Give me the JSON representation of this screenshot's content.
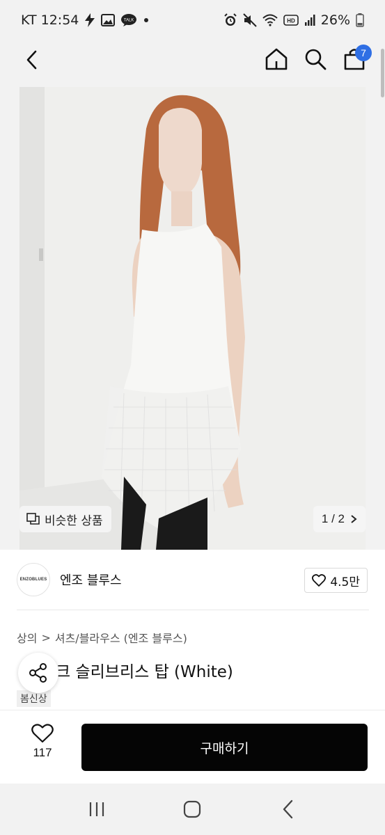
{
  "status_bar": {
    "carrier_time": "KT 12:54",
    "battery": "26%",
    "icons": [
      "bolt-icon",
      "gallery-icon",
      "talk-icon",
      "dot-icon",
      "alarm-icon",
      "mute-icon",
      "wifi-icon",
      "hd-icon",
      "signal-icon",
      "battery-icon"
    ],
    "talk_label": "TALK",
    "hd_label": "HD"
  },
  "header": {
    "cart_count": "7"
  },
  "hero": {
    "similar_label": "비슷한 상품",
    "page_indicator": "1 / 2"
  },
  "brand": {
    "logo_text": "ENZOBLUES",
    "name": "엔조 블루스",
    "likes": "4.5만"
  },
  "breadcrumb": {
    "category": "상의",
    "separator": ">",
    "subcategory": "셔츠/블라우스 (엔조 블루스)"
  },
  "product": {
    "title": "크 슬리브리스 탑 (White)",
    "tag": "봄신상"
  },
  "action_bar": {
    "wish_count": "117",
    "buy_label": "구매하기"
  },
  "colors": {
    "badge": "#2f6fe4",
    "buy_button": "#050505"
  }
}
